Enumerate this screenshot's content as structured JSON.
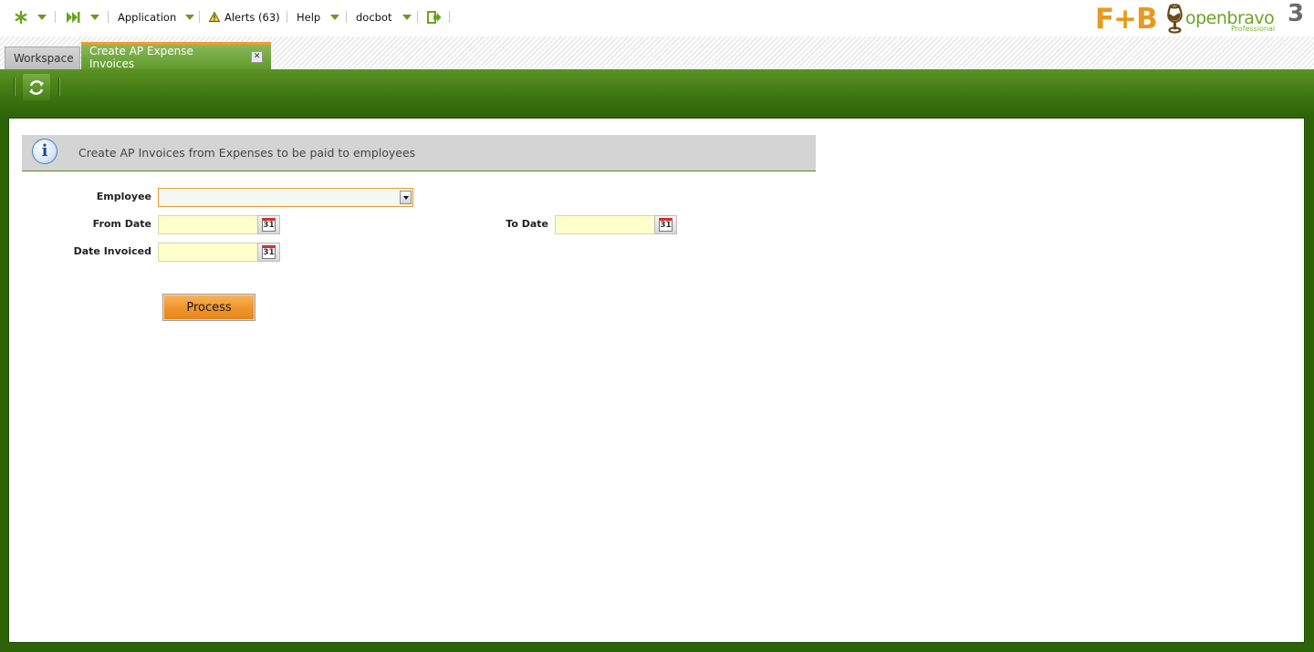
{
  "navbar": {
    "application_label": "Application",
    "alerts_label": "Alerts (63)",
    "help_label": "Help",
    "user_label": "docbot"
  },
  "logos": {
    "customer_logo_text": "F+B",
    "vendor_logo_text": "openbravo",
    "vendor_logo_sub": "Professional",
    "vendor_logo_version": "3"
  },
  "tabs": [
    {
      "label": "Workspace"
    },
    {
      "label": "Create AP Expense Invoices"
    }
  ],
  "message": {
    "text": "Create AP Invoices from Expenses to be paid to employees"
  },
  "form": {
    "employee_label": "Employee",
    "employee_value": "",
    "from_date_label": "From Date",
    "from_date_value": "",
    "to_date_label": "To Date",
    "to_date_value": "",
    "date_invoiced_label": "Date Invoiced",
    "date_invoiced_value": "",
    "calendar_day": "31",
    "process_label": "Process"
  },
  "icons": {
    "quick_launch": "asterisk-icon",
    "recent": "skip-forward-icon",
    "alerts": "warning-icon",
    "logout": "logout-icon",
    "refresh": "refresh-icon",
    "info": "info-icon",
    "calendar": "calendar-icon"
  },
  "colors": {
    "brand_green": "#2c6307",
    "accent_orange": "#f09630",
    "date_field_bg": "#ffffcc"
  }
}
